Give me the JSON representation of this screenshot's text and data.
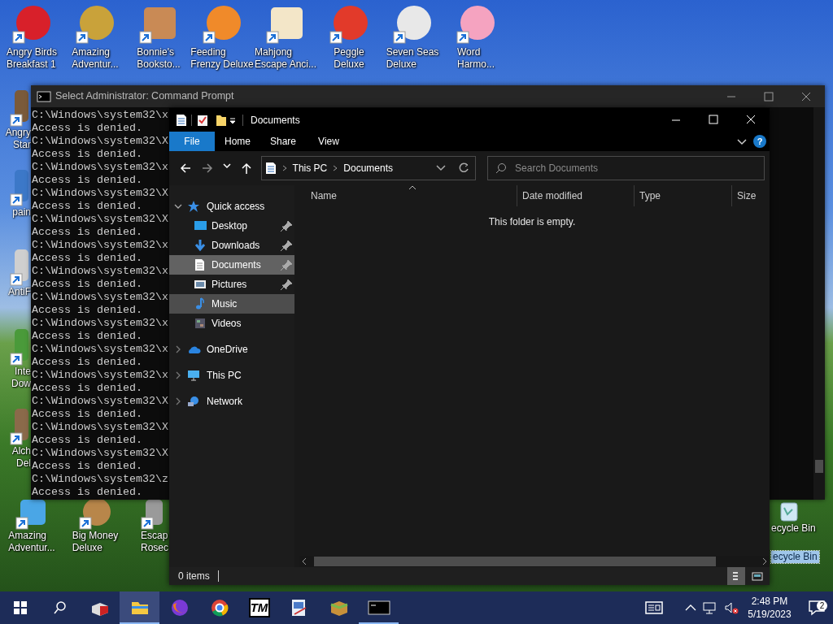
{
  "desktop": {
    "top_row": [
      {
        "label": "Angry Birds\nBreakfast 1"
      },
      {
        "label": "Amazing\nAdventur..."
      },
      {
        "label": "Bonnie's\nBooksto..."
      },
      {
        "label": "Feeding\nFrenzy Deluxe"
      },
      {
        "label": "Mahjong\nEscape Anci..."
      },
      {
        "label": "Peggle\nDeluxe"
      },
      {
        "label": "Seven Seas\nDeluxe"
      },
      {
        "label": "Word\nHarmo..."
      }
    ],
    "left_column": [
      {
        "label": "Angry\nStar"
      },
      {
        "label": "pain"
      },
      {
        "label": "AntiF"
      },
      {
        "label": "Inte\nDow"
      },
      {
        "label": "Alch\nDel"
      }
    ],
    "bottom_row": [
      {
        "label": "Amazing\nAdventur..."
      },
      {
        "label": "Big Money\nDeluxe"
      },
      {
        "label": "Escap\nRosec"
      }
    ],
    "recycle_bin": {
      "labels": [
        {
          "text": "ecycle Bin",
          "selected": false
        },
        {
          "text": "ecycle Bin",
          "selected": true
        }
      ]
    }
  },
  "console": {
    "title": "Select Administrator: Command Prompt",
    "lines": [
      "C:\\Windows\\system32\\x",
      "Access is denied.",
      "C:\\Windows\\system32\\X",
      "Access is denied.",
      "C:\\Windows\\system32\\x",
      "Access is denied.",
      "C:\\Windows\\system32\\X",
      "Access is denied.",
      "C:\\Windows\\system32\\X",
      "Access is denied.",
      "C:\\Windows\\system32\\x",
      "Access is denied.",
      "C:\\Windows\\system32\\x",
      "Access is denied.",
      "C:\\Windows\\system32\\x",
      "Access is denied.",
      "C:\\Windows\\system32\\x",
      "Access is denied.",
      "C:\\Windows\\system32\\x",
      "Access is denied.",
      "C:\\Windows\\system32\\x",
      "Access is denied.",
      "C:\\Windows\\system32\\X",
      "Access is denied.",
      "C:\\Windows\\system32\\X",
      "Access is denied.",
      "C:\\Windows\\system32\\X",
      "Access is denied.",
      "C:\\Windows\\system32\\z",
      "Access is denied."
    ]
  },
  "explorer": {
    "title": "Documents",
    "ribbon_tabs": [
      {
        "label": "File",
        "kind": "file"
      },
      {
        "label": "Home",
        "kind": "tab"
      },
      {
        "label": "Share",
        "kind": "tab"
      },
      {
        "label": "View",
        "kind": "tab"
      }
    ],
    "help": "?",
    "breadcrumbs": [
      "This PC",
      "Documents"
    ],
    "search": {
      "placeholder": "Search Documents"
    },
    "nav_pane": [
      {
        "label": "Quick access",
        "expanded": true,
        "selected": false,
        "hovered": false,
        "children": [
          {
            "label": "Desktop",
            "pinned": true,
            "selected": false,
            "hovered": false
          },
          {
            "label": "Downloads",
            "pinned": true,
            "selected": false,
            "hovered": false
          },
          {
            "label": "Documents",
            "pinned": true,
            "selected": true,
            "hovered": false
          },
          {
            "label": "Pictures",
            "pinned": true,
            "selected": false,
            "hovered": false
          },
          {
            "label": "Music",
            "pinned": false,
            "selected": false,
            "hovered": true
          },
          {
            "label": "Videos",
            "pinned": false,
            "selected": false,
            "hovered": false
          }
        ]
      },
      {
        "label": "OneDrive",
        "expanded": false,
        "selected": false,
        "hovered": false
      },
      {
        "label": "This PC",
        "expanded": false,
        "selected": false,
        "hovered": false
      },
      {
        "label": "Network",
        "expanded": false,
        "selected": false,
        "hovered": false
      }
    ],
    "columns": [
      {
        "label": "Name",
        "sorted": true
      },
      {
        "label": "Date modified",
        "sorted": false
      },
      {
        "label": "Type",
        "sorted": false
      },
      {
        "label": "Size",
        "sorted": false
      }
    ],
    "empty_message": "This folder is empty.",
    "status": "0 items",
    "views": [
      {
        "kind": "details",
        "selected": true
      },
      {
        "kind": "large",
        "selected": false
      }
    ]
  },
  "taskbar": {
    "apps": [
      {
        "active": false,
        "running": false
      },
      {
        "active": true,
        "running": true
      },
      {
        "active": false,
        "running": false
      },
      {
        "active": false,
        "running": false
      },
      {
        "active": false,
        "running": false,
        "logo_text": "TM"
      },
      {
        "active": false,
        "running": false
      },
      {
        "active": false,
        "running": false
      },
      {
        "active": false,
        "running": true
      }
    ],
    "time": "2:48 PM",
    "date": "5/19/2023",
    "notifications": "2"
  }
}
